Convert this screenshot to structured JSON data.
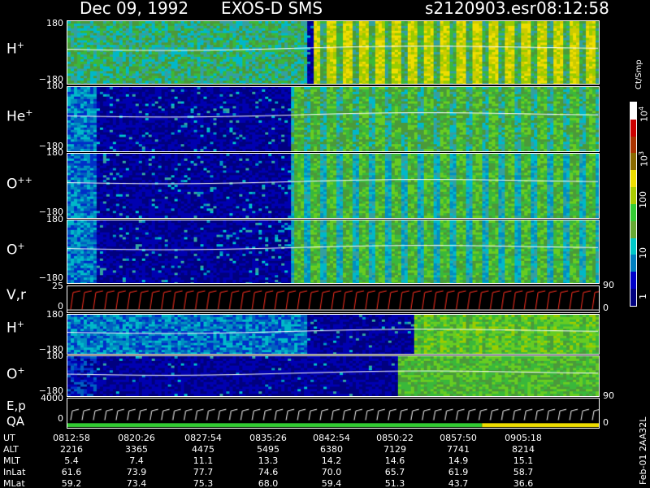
{
  "header": {
    "date": "Dec 09, 1992",
    "mission": "EXOS-D SMS",
    "file": "s2120903.esr",
    "time": "08:12:58"
  },
  "colorbar": {
    "unit": "Ct/Smp",
    "labels": [
      "1",
      "10",
      "100",
      "10",
      "10"
    ],
    "exponents": [
      "",
      "",
      "",
      "3",
      "4"
    ],
    "colors": [
      "#00007f",
      "#0000c8",
      "#007fbf",
      "#00c8c8",
      "#66a833",
      "#33cc33",
      "#aacc00",
      "#eedd00",
      "#8a6a00",
      "#aa3300",
      "#cc0000",
      "#ffffff"
    ]
  },
  "panels": [
    {
      "label": "H",
      "sup": "+",
      "ymax": "180",
      "ymin": "−180"
    },
    {
      "label": "He",
      "sup": "+",
      "ymax": "180",
      "ymin": "−180"
    },
    {
      "label": "O",
      "sup": "++",
      "ymax": "180",
      "ymin": "−180"
    },
    {
      "label": "O",
      "sup": "+",
      "ymax": "180",
      "ymin": "−180"
    },
    {
      "label": "V,r",
      "sup": "",
      "ymax": "25",
      "ymin": "0",
      "rmax": "90",
      "rmin": "0"
    },
    {
      "label": "H",
      "sup": "+",
      "ymax": "180",
      "ymin": "−180"
    },
    {
      "label": "O",
      "sup": "+",
      "ymax": "180",
      "ymin": "−180"
    },
    {
      "label": "E,p",
      "label2": "QA",
      "sup": "",
      "ymax": "4000",
      "ymin": "0",
      "rmax": "90",
      "rmin": "0"
    }
  ],
  "side_id": "Feb-01 2AA32L",
  "ephemeris": {
    "rows": [
      {
        "name": "UT",
        "values": [
          "0812:58",
          "0820:26",
          "0827:54",
          "0835:26",
          "0842:54",
          "0850:22",
          "0857:50",
          "0905:18"
        ]
      },
      {
        "name": "ALT",
        "values": [
          "2216",
          "3365",
          "4475",
          "5495",
          "6380",
          "7129",
          "7741",
          "8214"
        ]
      },
      {
        "name": "MLT",
        "values": [
          "5.4",
          "7.4",
          "11.1",
          "13.3",
          "14.2",
          "14.6",
          "14.9",
          "15.1"
        ]
      },
      {
        "name": "InLat",
        "values": [
          "61.6",
          "73.9",
          "77.7",
          "74.6",
          "70.0",
          "65.7",
          "61.9",
          "58.7"
        ]
      },
      {
        "name": "MLat",
        "values": [
          "59.2",
          "73.4",
          "75.3",
          "68.0",
          "59.4",
          "51.3",
          "43.7",
          "36.6"
        ]
      }
    ]
  },
  "chart_data": {
    "type": "heatmap",
    "title": "Dec 09, 1992   EXOS-D SMS   s2120903.esr   08:12:58",
    "x_tick_labels": [
      "0812:58",
      "0820:26",
      "0827:54",
      "0835:26",
      "0842:54",
      "0850:22",
      "0857:50",
      "0905:18"
    ],
    "colorbar_label": "Ct/Smp",
    "colorbar_range": [
      "1",
      "10^4"
    ],
    "series": [
      {
        "name": "H+",
        "ylim": [
          -180,
          180
        ]
      },
      {
        "name": "He+",
        "ylim": [
          -180,
          180
        ]
      },
      {
        "name": "O++",
        "ylim": [
          -180,
          180
        ]
      },
      {
        "name": "O+",
        "ylim": [
          -180,
          180
        ]
      },
      {
        "name": "V,r",
        "ylim": [
          0,
          25
        ],
        "right_ylim": [
          0,
          90
        ]
      },
      {
        "name": "H+",
        "ylim": [
          -180,
          180
        ]
      },
      {
        "name": "O+",
        "ylim": [
          -180,
          180
        ]
      },
      {
        "name": "E,p / QA",
        "ylim": [
          0,
          4000
        ],
        "right_ylim": [
          0,
          90
        ]
      }
    ]
  }
}
